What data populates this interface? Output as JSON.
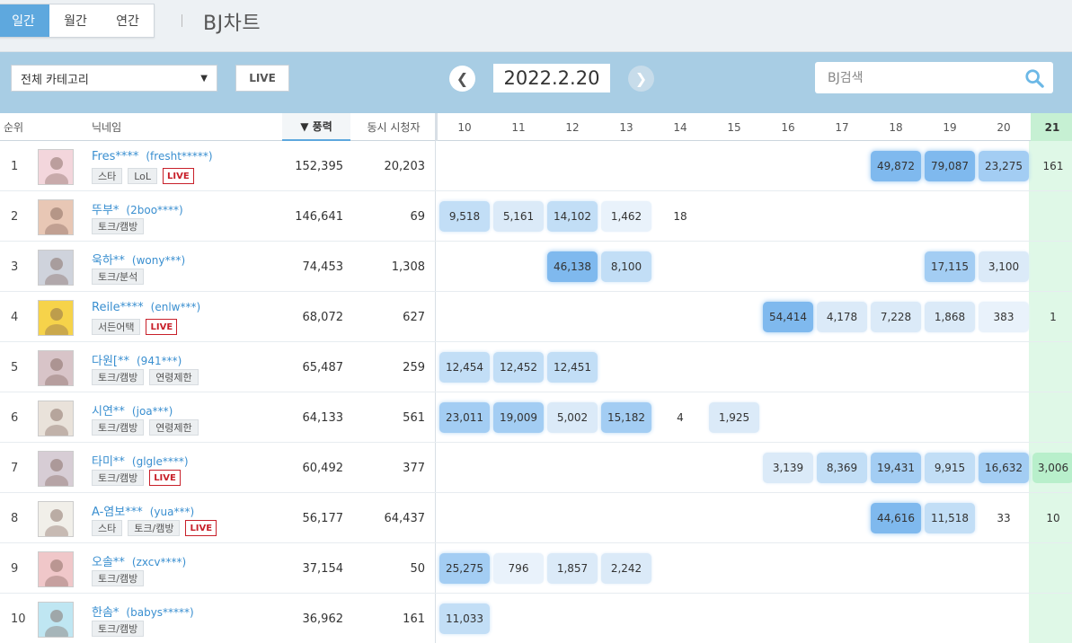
{
  "period_tabs": [
    {
      "label": "일간",
      "active": true
    },
    {
      "label": "월간",
      "active": false
    },
    {
      "label": "연간",
      "active": false
    }
  ],
  "page_title": "BJ차트",
  "toolbar": {
    "category": "전체 카테고리",
    "live_label": "LIVE",
    "date": "2022.2.20",
    "prev_icon": "chevron-left-icon",
    "next_icon": "chevron-right-icon",
    "search_placeholder": "BJ검색",
    "search_icon": "search-icon"
  },
  "table_header": {
    "rank": "순위",
    "nickname": "닉네임",
    "power": "▼ 풍력",
    "viewers": "동시 시청자",
    "days": [
      "10",
      "11",
      "12",
      "13",
      "14",
      "15",
      "16",
      "17",
      "18",
      "19",
      "20",
      "21"
    ],
    "today": "21"
  },
  "colors": {
    "accent": "#5ea8de",
    "toolbar": "#a8cde4",
    "live_red": "#c8202a",
    "nick_blue": "#3a8fd0",
    "today_green": "#dff8e7"
  },
  "rows": [
    {
      "rank": "1",
      "name": "Fres****",
      "uid": "(fresht*****)",
      "tags": [
        "스타",
        "LoL"
      ],
      "live": true,
      "power": "152,395",
      "viewers": "20,203",
      "days": [
        "",
        "",
        "",
        "",
        "",
        "",
        "",
        "",
        "49,872",
        "79,087",
        "23,275",
        "161"
      ]
    },
    {
      "rank": "2",
      "name": "뚜부*",
      "uid": "(2boo****)",
      "tags": [
        "토크/캠방"
      ],
      "live": false,
      "power": "146,641",
      "viewers": "69",
      "days": [
        "9,518",
        "5,161",
        "14,102",
        "1,462",
        "18",
        "",
        "",
        "",
        "",
        "",
        "",
        ""
      ]
    },
    {
      "rank": "3",
      "name": "욱하**",
      "uid": "(wony***)",
      "tags": [
        "토크/분석"
      ],
      "live": false,
      "power": "74,453",
      "viewers": "1,308",
      "days": [
        "",
        "",
        "46,138",
        "8,100",
        "",
        "",
        "",
        "",
        "",
        "17,115",
        "3,100",
        ""
      ]
    },
    {
      "rank": "4",
      "name": "Reile****",
      "uid": "(enlw***)",
      "tags": [
        "서든어택"
      ],
      "live": true,
      "power": "68,072",
      "viewers": "627",
      "days": [
        "",
        "",
        "",
        "",
        "",
        "",
        "54,414",
        "4,178",
        "7,228",
        "1,868",
        "383",
        "1"
      ]
    },
    {
      "rank": "5",
      "name": "다원[**",
      "uid": "(941***)",
      "tags": [
        "토크/캠방",
        "연령제한"
      ],
      "live": false,
      "power": "65,487",
      "viewers": "259",
      "days": [
        "12,454",
        "12,452",
        "12,451",
        "",
        "",
        "",
        "",
        "",
        "",
        "",
        "",
        ""
      ]
    },
    {
      "rank": "6",
      "name": "시연**",
      "uid": "(joa***)",
      "tags": [
        "토크/캠방",
        "연령제한"
      ],
      "live": false,
      "power": "64,133",
      "viewers": "561",
      "days": [
        "23,011",
        "19,009",
        "5,002",
        "15,182",
        "4",
        "1,925",
        "",
        "",
        "",
        "",
        "",
        ""
      ]
    },
    {
      "rank": "7",
      "name": "타미**",
      "uid": "(glgle****)",
      "tags": [
        "토크/캠방"
      ],
      "live": true,
      "power": "60,492",
      "viewers": "377",
      "days": [
        "",
        "",
        "",
        "",
        "",
        "",
        "3,139",
        "8,369",
        "19,431",
        "9,915",
        "16,632",
        "3,006"
      ]
    },
    {
      "rank": "8",
      "name": "A-염보***",
      "uid": "(yua***)",
      "tags": [
        "스타",
        "토크/캠방"
      ],
      "live": true,
      "power": "56,177",
      "viewers": "64,437",
      "days": [
        "",
        "",
        "",
        "",
        "",
        "",
        "",
        "",
        "44,616",
        "11,518",
        "33",
        "10"
      ]
    },
    {
      "rank": "9",
      "name": "오솔**",
      "uid": "(zxcv****)",
      "tags": [
        "토크/캠방"
      ],
      "live": false,
      "power": "37,154",
      "viewers": "50",
      "days": [
        "25,275",
        "796",
        "1,857",
        "2,242",
        "",
        "",
        "",
        "",
        "",
        "",
        "",
        ""
      ]
    },
    {
      "rank": "10",
      "name": "한솜*",
      "uid": "(babys*****)",
      "tags": [
        "토크/캠방"
      ],
      "live": false,
      "power": "36,962",
      "viewers": "161",
      "days": [
        "11,033",
        "",
        "",
        "",
        "",
        "",
        "",
        "",
        "",
        "",
        "",
        ""
      ]
    }
  ],
  "live_badge": "LIVE"
}
